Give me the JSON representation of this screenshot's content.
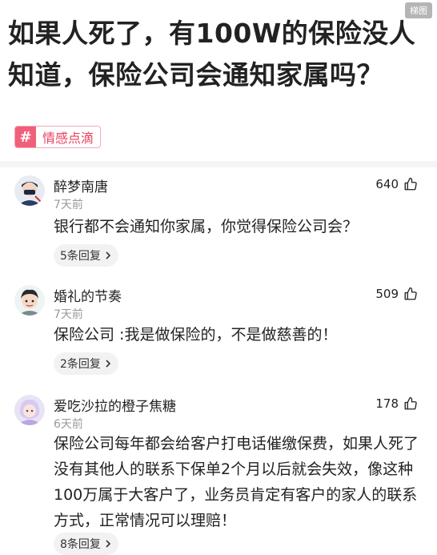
{
  "watermark": "梯图",
  "title": "如果人死了，有100W的保险没人知道，保险公司会通知家属吗？",
  "tag": {
    "icon": "#",
    "label": "情感点滴"
  },
  "comments": [
    {
      "user": "醉梦南唐",
      "time": "7天前",
      "likes": "640",
      "text": "银行都不会通知你家属，你觉得保险公司会？",
      "replies": "5条回复"
    },
    {
      "user": "婚礼的节奏",
      "time": "7天前",
      "likes": "509",
      "text": "保险公司 :我是做保险的，不是做慈善的！",
      "replies": "2条回复"
    },
    {
      "user": "爱吃沙拉的橙子焦糖",
      "time": "6天前",
      "likes": "178",
      "text": "保险公司每年都会给客户打电话催缴保费，如果人死了没有其他人的联系下保单2个月以后就会失效，像这种100万属于大客户了，业务员肯定有客户的家人的联系方式，正常情况可以理赔！",
      "replies": "8条回复"
    }
  ],
  "icons": {
    "like": "thumbs-up-icon",
    "chevron": "chevron-right-icon"
  }
}
